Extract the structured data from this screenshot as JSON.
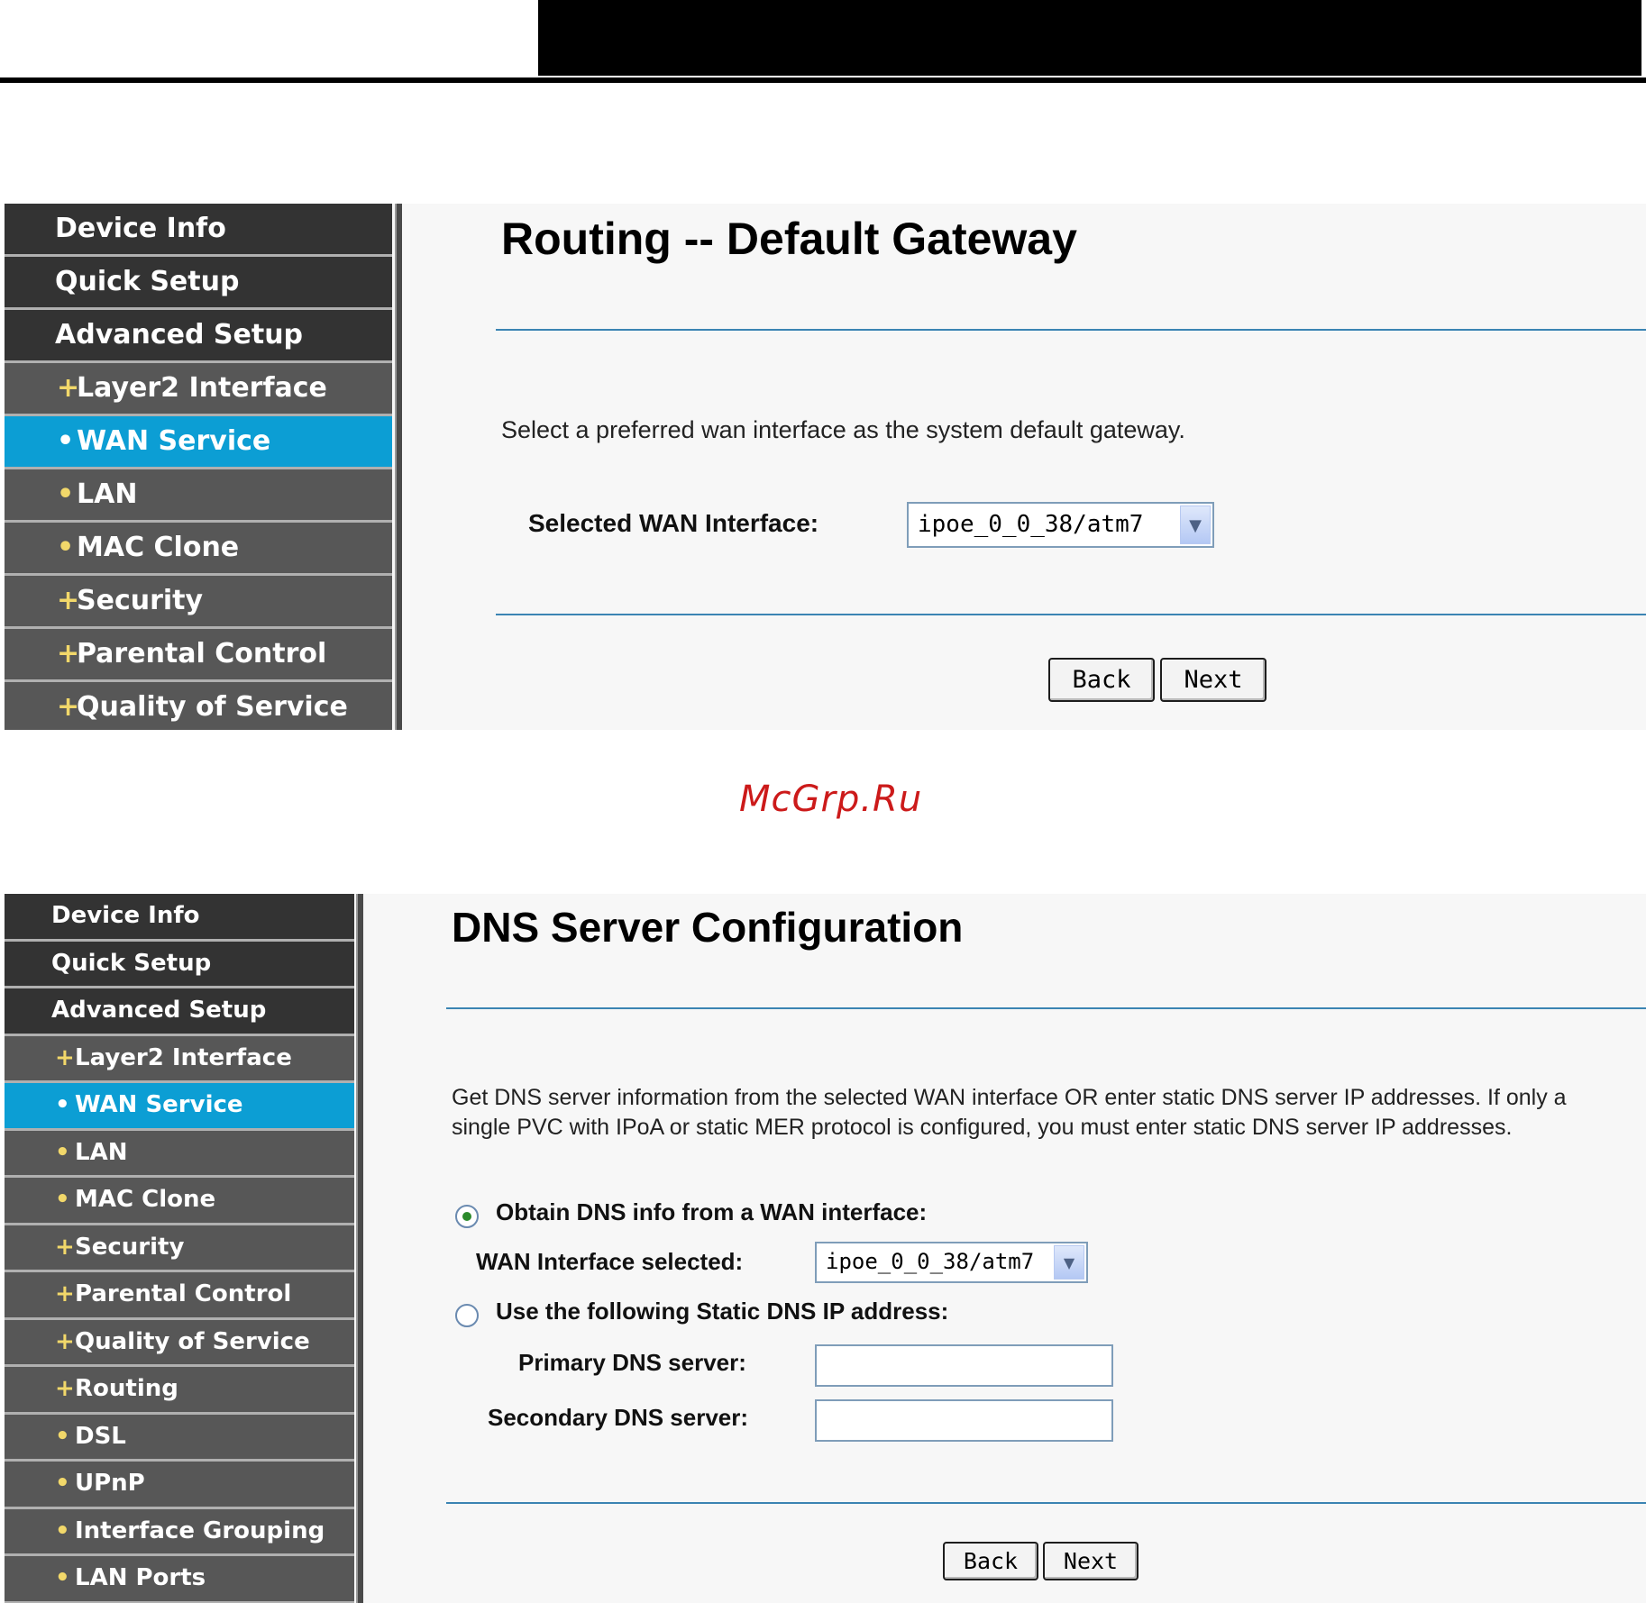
{
  "watermark": "McGrp.Ru",
  "routing_screen": {
    "sidebar": [
      {
        "label": "Device Info",
        "level": "top",
        "marker": ""
      },
      {
        "label": "Quick Setup",
        "level": "top",
        "marker": ""
      },
      {
        "label": "Advanced Setup",
        "level": "top",
        "marker": ""
      },
      {
        "label": "Layer2 Interface",
        "level": "sub",
        "marker": "+"
      },
      {
        "label": "WAN Service",
        "level": "sub",
        "marker": "•",
        "active": true
      },
      {
        "label": "LAN",
        "level": "sub",
        "marker": "•"
      },
      {
        "label": "MAC Clone",
        "level": "sub",
        "marker": "•"
      },
      {
        "label": "Security",
        "level": "sub",
        "marker": "+"
      },
      {
        "label": "Parental Control",
        "level": "sub",
        "marker": "+"
      },
      {
        "label": "Quality of Service",
        "level": "sub",
        "marker": "+"
      }
    ],
    "title": "Routing -- Default Gateway",
    "description": "Select a preferred wan interface as the system default gateway.",
    "wan_label": "Selected WAN Interface:",
    "wan_value": "ipoe_0_0_38/atm7",
    "back_label": "Back",
    "next_label": "Next"
  },
  "dns_screen": {
    "sidebar": [
      {
        "label": "Device Info",
        "level": "top",
        "marker": ""
      },
      {
        "label": "Quick Setup",
        "level": "top",
        "marker": ""
      },
      {
        "label": "Advanced Setup",
        "level": "top",
        "marker": ""
      },
      {
        "label": "Layer2 Interface",
        "level": "sub",
        "marker": "+"
      },
      {
        "label": "WAN Service",
        "level": "sub",
        "marker": "•",
        "active": true
      },
      {
        "label": "LAN",
        "level": "sub",
        "marker": "•"
      },
      {
        "label": "MAC Clone",
        "level": "sub",
        "marker": "•"
      },
      {
        "label": "Security",
        "level": "sub",
        "marker": "+"
      },
      {
        "label": "Parental Control",
        "level": "sub",
        "marker": "+"
      },
      {
        "label": "Quality of Service",
        "level": "sub",
        "marker": "+"
      },
      {
        "label": "Routing",
        "level": "sub",
        "marker": "+"
      },
      {
        "label": "DSL",
        "level": "sub",
        "marker": "•"
      },
      {
        "label": "UPnP",
        "level": "sub",
        "marker": "•"
      },
      {
        "label": "Interface Grouping",
        "level": "sub",
        "marker": "•"
      },
      {
        "label": "LAN Ports",
        "level": "sub",
        "marker": "•"
      }
    ],
    "title": "DNS Server Configuration",
    "description_line1": "Get DNS server information from the selected WAN interface OR enter static DNS server IP addresses. If only a",
    "description_line2": "single PVC with IPoA or static MER protocol is configured, you must enter static DNS server IP addresses.",
    "obtain_label": "Obtain DNS info from a WAN interface:",
    "obtain_checked": true,
    "wan_label": "WAN Interface selected:",
    "wan_value": "ipoe_0_0_38/atm7",
    "static_label": "Use the following Static DNS IP address:",
    "primary_label": "Primary DNS server:",
    "primary_value": "",
    "secondary_label": "Secondary DNS server:",
    "secondary_value": "",
    "back_label": "Back",
    "next_label": "Next"
  }
}
